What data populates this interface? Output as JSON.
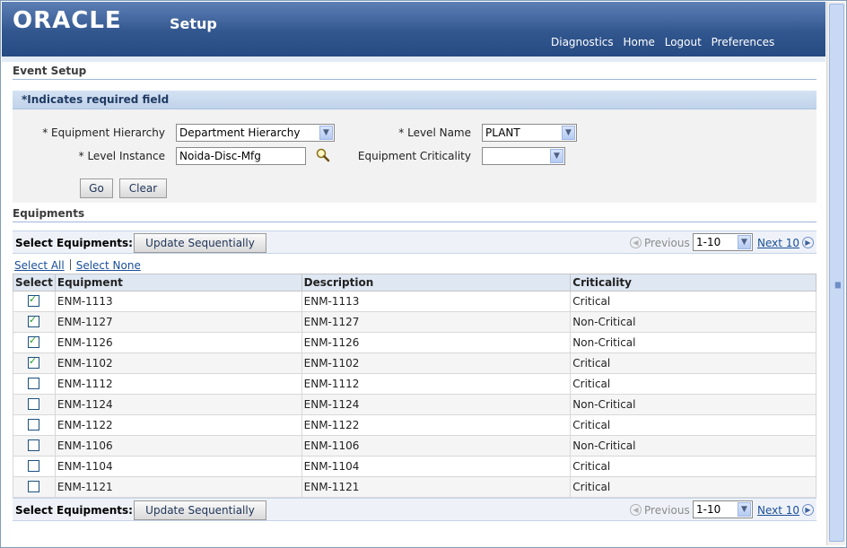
{
  "header": {
    "logo": "ORACLE",
    "title": "Setup",
    "links": [
      "Diagnostics",
      "Home",
      "Logout",
      "Preferences"
    ]
  },
  "page": {
    "title": "Event Setup",
    "required_note": "*Indicates required field"
  },
  "search": {
    "equipment_hierarchy_label": "* Equipment Hierarchy",
    "equipment_hierarchy_value": "Department Hierarchy",
    "level_name_label": "* Level Name",
    "level_name_value": "PLANT",
    "level_instance_label": "* Level Instance",
    "level_instance_value": "Noida-Disc-Mfg",
    "criticality_label": "Equipment Criticality",
    "criticality_value": "",
    "go_label": "Go",
    "clear_label": "Clear"
  },
  "equipments": {
    "section_title": "Equipments",
    "select_label": "Select Equipments:",
    "update_button": "Update Sequentially",
    "previous": "Previous",
    "range": "1-10",
    "next": "Next 10",
    "select_all": "Select All",
    "select_none": "Select None",
    "columns": [
      "Select",
      "Equipment",
      "Description",
      "Criticality"
    ],
    "rows": [
      {
        "checked": true,
        "equipment": "ENM-1113",
        "description": "ENM-1113",
        "criticality": "Critical"
      },
      {
        "checked": true,
        "equipment": "ENM-1127",
        "description": "ENM-1127",
        "criticality": "Non-Critical"
      },
      {
        "checked": true,
        "equipment": "ENM-1126",
        "description": "ENM-1126",
        "criticality": "Non-Critical"
      },
      {
        "checked": true,
        "equipment": "ENM-1102",
        "description": "ENM-1102",
        "criticality": "Critical"
      },
      {
        "checked": false,
        "equipment": "ENM-1112",
        "description": "ENM-1112",
        "criticality": "Critical"
      },
      {
        "checked": false,
        "equipment": "ENM-1124",
        "description": "ENM-1124",
        "criticality": "Non-Critical"
      },
      {
        "checked": false,
        "equipment": "ENM-1122",
        "description": "ENM-1122",
        "criticality": "Critical"
      },
      {
        "checked": false,
        "equipment": "ENM-1106",
        "description": "ENM-1106",
        "criticality": "Non-Critical"
      },
      {
        "checked": false,
        "equipment": "ENM-1104",
        "description": "ENM-1104",
        "criticality": "Critical"
      },
      {
        "checked": false,
        "equipment": "ENM-1121",
        "description": "ENM-1121",
        "criticality": "Critical"
      }
    ]
  }
}
